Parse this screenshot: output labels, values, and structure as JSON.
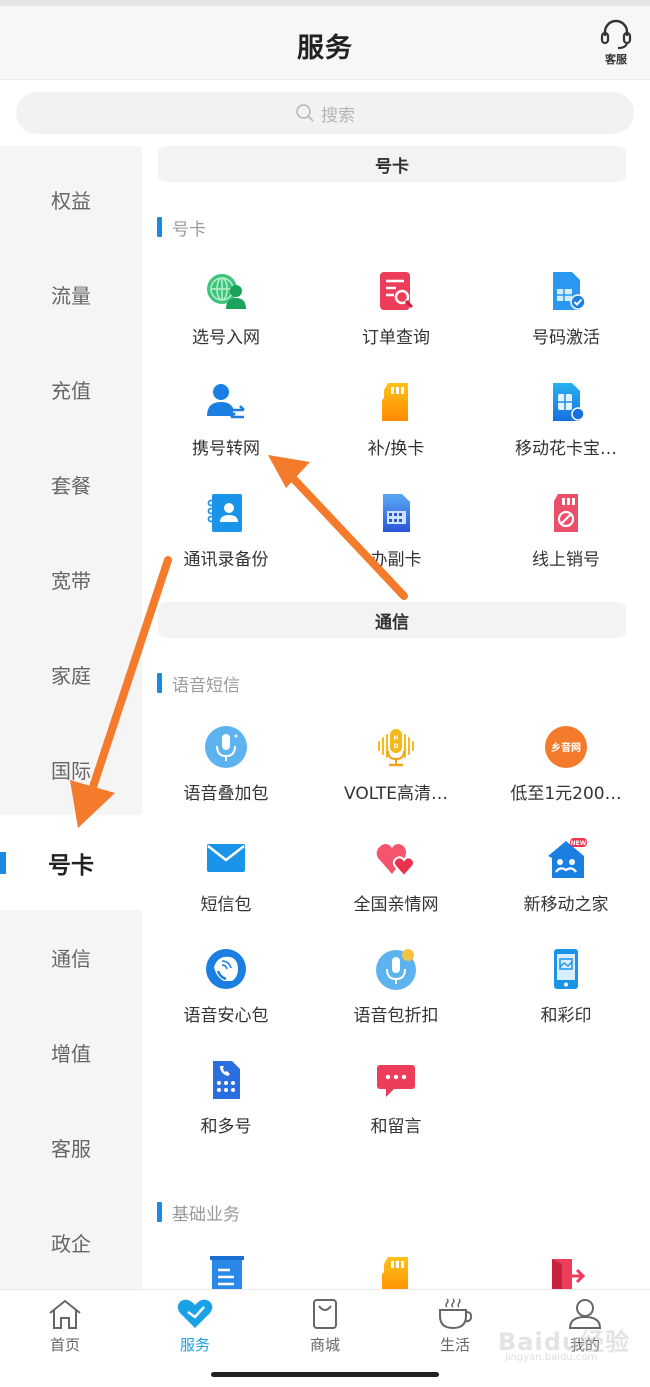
{
  "header": {
    "title": "服务",
    "customer_service_label": "客服"
  },
  "search": {
    "placeholder": "搜索"
  },
  "sidebar": {
    "items": [
      {
        "label": "权益"
      },
      {
        "label": "流量"
      },
      {
        "label": "充值"
      },
      {
        "label": "套餐"
      },
      {
        "label": "宽带"
      },
      {
        "label": "家庭"
      },
      {
        "label": "国际"
      },
      {
        "label": "号卡",
        "active": true
      },
      {
        "label": "通信"
      },
      {
        "label": "增值"
      },
      {
        "label": "客服"
      },
      {
        "label": "政企"
      }
    ]
  },
  "content": {
    "categories": [
      {
        "title": "号卡",
        "groups": [
          {
            "title": "号卡",
            "items": [
              {
                "label": "选号入网",
                "icon": "globe-user-icon"
              },
              {
                "label": "订单查询",
                "icon": "order-search-icon"
              },
              {
                "label": "号码激活",
                "icon": "sim-check-icon"
              },
              {
                "label": "携号转网",
                "icon": "user-transfer-icon"
              },
              {
                "label": "补/换卡",
                "icon": "sd-card-icon"
              },
              {
                "label": "移动花卡宝…",
                "icon": "sim-card-icon"
              },
              {
                "label": "通讯录备份",
                "icon": "contacts-book-icon"
              },
              {
                "label": "办副卡",
                "icon": "sub-card-icon"
              },
              {
                "label": "线上销号",
                "icon": "card-cancel-icon"
              }
            ]
          }
        ]
      },
      {
        "title": "通信",
        "groups": [
          {
            "title": "语音短信",
            "items": [
              {
                "label": "语音叠加包",
                "icon": "microphone-icon"
              },
              {
                "label": "VOLTE高清…",
                "icon": "hd-microphone-icon"
              },
              {
                "label": "低至1元200…",
                "icon": "township-network-icon",
                "icon_text": "乡音网"
              },
              {
                "label": "短信包",
                "icon": "envelope-icon"
              },
              {
                "label": "全国亲情网",
                "icon": "hearts-icon"
              },
              {
                "label": "新移动之家",
                "icon": "family-home-icon",
                "badge": "NEW"
              },
              {
                "label": "语音安心包",
                "icon": "phone-shield-icon"
              },
              {
                "label": "语音包折扣",
                "icon": "microphone-discount-icon"
              },
              {
                "label": "和彩印",
                "icon": "phone-image-icon"
              },
              {
                "label": "和多号",
                "icon": "dialpad-card-icon"
              },
              {
                "label": "和留言",
                "icon": "chat-bubble-icon"
              }
            ]
          },
          {
            "title": "基础业务",
            "items": [
              {
                "label": "",
                "icon": "document-list-icon"
              },
              {
                "label": "",
                "icon": "sd-card-icon"
              },
              {
                "label": "",
                "icon": "exit-door-icon"
              }
            ]
          }
        ]
      }
    ]
  },
  "bottom_nav": {
    "items": [
      {
        "label": "首页",
        "icon": "home-icon"
      },
      {
        "label": "服务",
        "icon": "heart-icon",
        "active": true
      },
      {
        "label": "商城",
        "icon": "shopping-bag-icon"
      },
      {
        "label": "生活",
        "icon": "coffee-cup-icon"
      },
      {
        "label": "我的",
        "icon": "user-icon"
      }
    ]
  },
  "watermark": {
    "text": "Baidu经验",
    "sub": "jingyan.baidu.com"
  },
  "colors": {
    "accent": "#1e88e5",
    "nav_active": "#1aa1e6",
    "annotation_arrow": "#f47a2c"
  }
}
